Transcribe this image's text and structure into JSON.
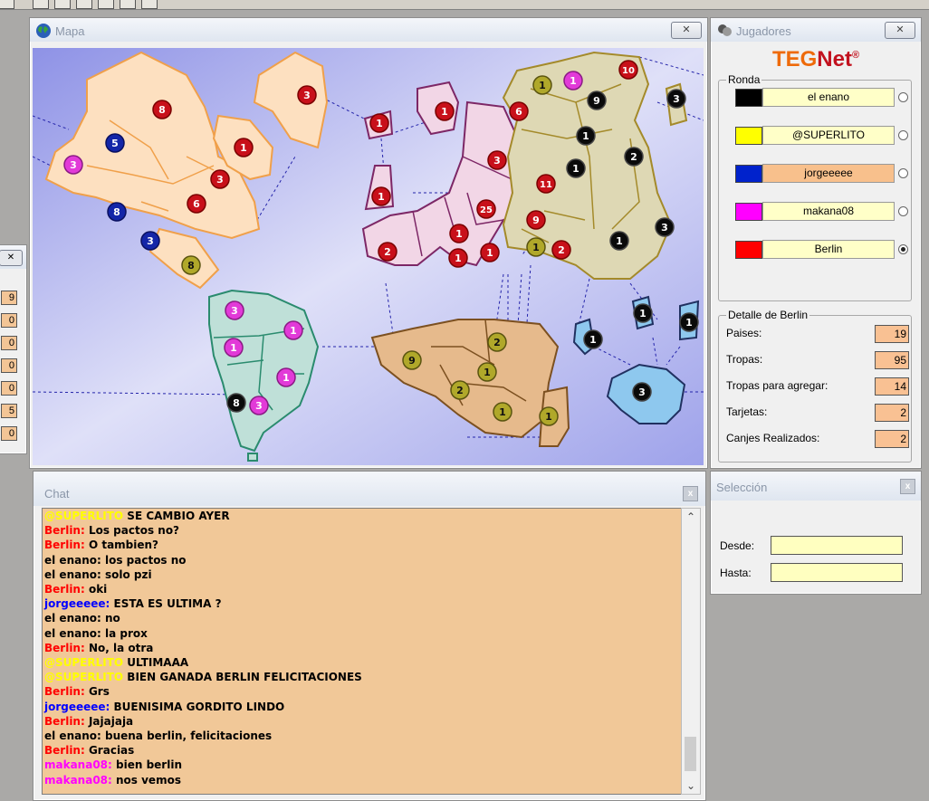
{
  "colors": {
    "black": "#000000",
    "yellow": "#ffff00",
    "blue": "#0022cc",
    "magenta": "#ff00ff",
    "red": "#ff0000",
    "player_name_bg": "#ffffc8",
    "active_name_bg": "#f8c08c",
    "chat_bg": "#f1c898"
  },
  "left_panel": {
    "values": [
      "9",
      "0",
      "0",
      "0",
      "0",
      "5",
      "0"
    ]
  },
  "map_window": {
    "title": "Mapa",
    "close": "✕",
    "armies": [
      {
        "n": "8",
        "c": "r"
      },
      {
        "n": "3",
        "c": "r"
      },
      {
        "n": "5",
        "c": "b"
      },
      {
        "n": "1",
        "c": "r"
      },
      {
        "n": "3",
        "c": "m"
      },
      {
        "n": "3",
        "c": "r"
      },
      {
        "n": "6",
        "c": "r"
      },
      {
        "n": "8",
        "c": "b"
      },
      {
        "n": "3",
        "c": "b"
      },
      {
        "n": "8",
        "c": "y"
      },
      {
        "n": "3",
        "c": "m"
      },
      {
        "n": "1",
        "c": "m"
      },
      {
        "n": "1",
        "c": "m"
      },
      {
        "n": "1",
        "c": "m"
      },
      {
        "n": "8",
        "c": "k"
      },
      {
        "n": "3",
        "c": "m"
      },
      {
        "n": "1",
        "c": "r"
      },
      {
        "n": "1",
        "c": "r"
      },
      {
        "n": "1",
        "c": "r"
      },
      {
        "n": "2",
        "c": "r"
      },
      {
        "n": "3",
        "c": "r"
      },
      {
        "n": "1",
        "c": "r"
      },
      {
        "n": "25",
        "c": "r"
      },
      {
        "n": "1",
        "c": "r"
      },
      {
        "n": "1",
        "c": "r"
      },
      {
        "n": "6",
        "c": "r"
      },
      {
        "n": "11",
        "c": "r"
      },
      {
        "n": "9",
        "c": "r"
      },
      {
        "n": "2",
        "c": "r"
      },
      {
        "n": "1",
        "c": "y"
      },
      {
        "n": "1",
        "c": "m"
      },
      {
        "n": "9",
        "c": "k"
      },
      {
        "n": "10",
        "c": "r"
      },
      {
        "n": "3",
        "c": "k"
      },
      {
        "n": "1",
        "c": "k"
      },
      {
        "n": "1",
        "c": "k"
      },
      {
        "n": "2",
        "c": "k"
      },
      {
        "n": "3",
        "c": "k"
      },
      {
        "n": "1",
        "c": "k"
      },
      {
        "n": "1",
        "c": "y"
      },
      {
        "n": "9",
        "c": "y"
      },
      {
        "n": "2",
        "c": "y"
      },
      {
        "n": "1",
        "c": "y"
      },
      {
        "n": "2",
        "c": "y"
      },
      {
        "n": "1",
        "c": "y"
      },
      {
        "n": "1",
        "c": "y"
      },
      {
        "n": "1",
        "c": "k"
      },
      {
        "n": "1",
        "c": "k"
      },
      {
        "n": "1",
        "c": "k"
      },
      {
        "n": "3",
        "c": "k"
      }
    ]
  },
  "players_window": {
    "title": "Jugadores",
    "close": "✕",
    "logo_teg": "TEG",
    "logo_net": "Net",
    "logo_mark": "®",
    "round_label": "Ronda",
    "players": [
      {
        "name": "el enano",
        "color": "#000000",
        "active": false,
        "selected": false
      },
      {
        "name": "@SUPERLITO",
        "color": "#ffff00",
        "active": false,
        "selected": false
      },
      {
        "name": "jorgeeeee",
        "color": "#0022cc",
        "active": true,
        "selected": false
      },
      {
        "name": "makana08",
        "color": "#ff00ff",
        "active": false,
        "selected": false
      },
      {
        "name": "Berlin",
        "color": "#ff0000",
        "active": false,
        "selected": true
      }
    ],
    "detail_label": "Detalle de Berlin",
    "details": [
      {
        "label": "Paises:",
        "value": "19"
      },
      {
        "label": "Tropas:",
        "value": "95"
      },
      {
        "label": "Tropas para agregar:",
        "value": "14"
      },
      {
        "label": "Tarjetas:",
        "value": "2"
      },
      {
        "label": "Canjes Realizados:",
        "value": "2"
      }
    ]
  },
  "chat_window": {
    "title": "Chat",
    "close": "x",
    "messages": [
      {
        "who": "@SUPERLITO",
        "color": "#ffff00",
        "text": " SE CAMBIO AYER"
      },
      {
        "who": "Berlin:",
        "color": "#ff0000",
        "text": " Los pactos no?"
      },
      {
        "who": "Berlin:",
        "color": "#ff0000",
        "text": " O tambien?"
      },
      {
        "who": "el enano:",
        "color": "#000000",
        "text": " los pactos no"
      },
      {
        "who": "el enano:",
        "color": "#000000",
        "text": " solo pzi"
      },
      {
        "who": "Berlin:",
        "color": "#ff0000",
        "text": " oki"
      },
      {
        "who": "jorgeeeee:",
        "color": "#0000ff",
        "text": " ESTA ES ULTIMA ?"
      },
      {
        "who": "el enano:",
        "color": "#000000",
        "text": " no"
      },
      {
        "who": "el enano:",
        "color": "#000000",
        "text": " la prox"
      },
      {
        "who": "Berlin:",
        "color": "#ff0000",
        "text": " No, la otra"
      },
      {
        "who": "@SUPERLITO",
        "color": "#ffff00",
        "text": " ULTIMAAA"
      },
      {
        "who": "@SUPERLITO",
        "color": "#ffff00",
        "text": " BIEN GANADA BERLIN FELICITACIONES"
      },
      {
        "who": "Berlin:",
        "color": "#ff0000",
        "text": " Grs"
      },
      {
        "who": "jorgeeeee:",
        "color": "#0000ff",
        "text": " BUENISIMA GORDITO LINDO"
      },
      {
        "who": "Berlin:",
        "color": "#ff0000",
        "text": " Jajajaja"
      },
      {
        "who": "el enano:",
        "color": "#000000",
        "text": " buena berlin, felicitaciones"
      },
      {
        "who": "Berlin:",
        "color": "#ff0000",
        "text": " Gracias"
      },
      {
        "who": "makana08:",
        "color": "#ff00ff",
        "text": " bien berlin"
      },
      {
        "who": "makana08:",
        "color": "#ff00ff",
        "text": " nos vemos"
      }
    ],
    "scroll_up": "⌃",
    "scroll_down": "⌄"
  },
  "selection_window": {
    "title": "Selección",
    "close": "x",
    "from_label": "Desde:",
    "to_label": "Hasta:",
    "from_value": "",
    "to_value": ""
  }
}
